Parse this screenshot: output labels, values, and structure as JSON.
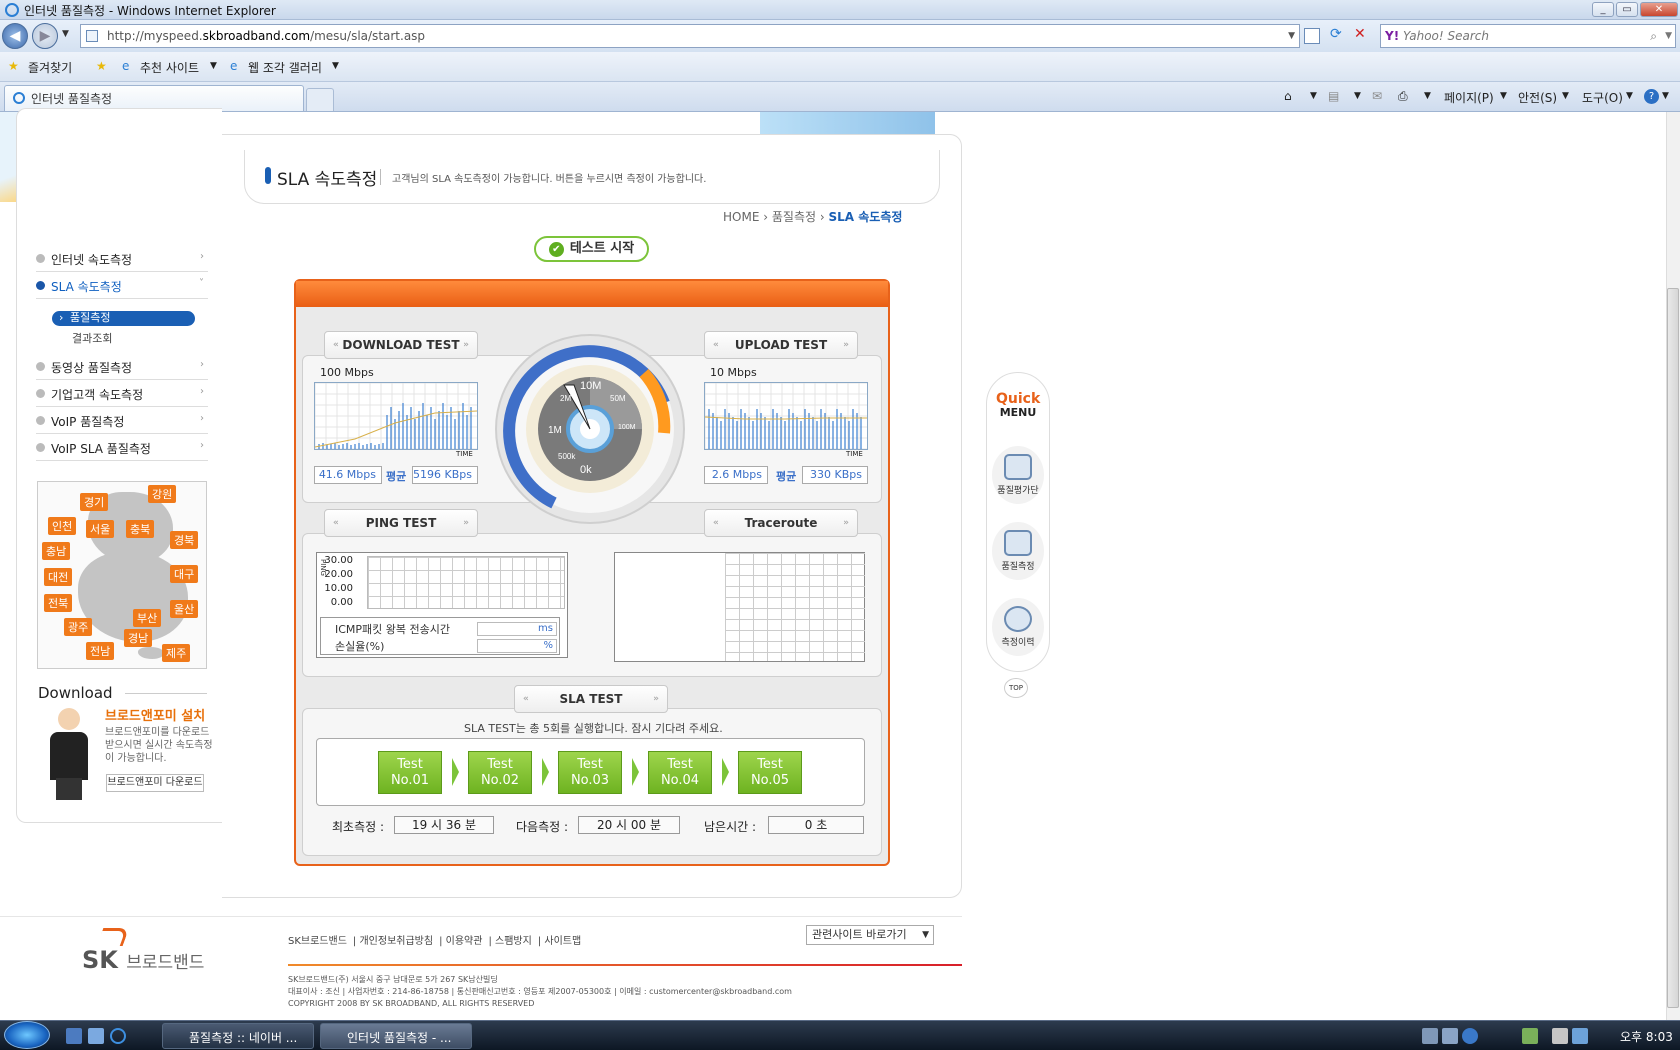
{
  "window": {
    "title": "인터넷 품질측정 - Windows Internet Explorer"
  },
  "browser": {
    "url_prefix": "http://myspeed.",
    "url_domain": "skbroadband.com",
    "url_path": "/mesu/sla/start.asp",
    "search_placeholder": "Yahoo! Search",
    "fav_label": "즐겨찾기",
    "fav_recommended": "추천 사이트",
    "fav_gallery": "웹 조각 갤러리",
    "tab_title": "인터넷 품질측정",
    "cmd_page": "페이지(P)",
    "cmd_safety": "안전(S)",
    "cmd_tools": "도구(O)"
  },
  "sidebar": {
    "items": [
      {
        "label": "인터넷 속도측정"
      },
      {
        "label": "SLA 속도측정"
      },
      {
        "label": "동영상 품질측정"
      },
      {
        "label": "기업고객 속도측정"
      },
      {
        "label": "VoIP 품질측정"
      },
      {
        "label": "VoIP SLA 품질측정"
      }
    ],
    "sub_items": [
      {
        "label": "품질측정"
      },
      {
        "label": "결과조회"
      }
    ],
    "map_regions": [
      "강원",
      "경기",
      "인천",
      "서울",
      "충북",
      "경북",
      "충남",
      "대전",
      "대구",
      "전북",
      "울산",
      "부산",
      "광주",
      "경남",
      "전남",
      "제주"
    ],
    "download": {
      "title": "Download",
      "heading": "브로드앤포미 설치",
      "text": "브로드앤포미를 다운로드 받으시면 실시간 속도측정이 가능합니다.",
      "button": "브로드앤포미 다운로드"
    }
  },
  "header": {
    "title": "SLA 속도측정",
    "description": "고객님의 SLA 속도측정이 가능합니다.  버튼을 누르시면 측정이 가능합니다.",
    "breadcrumb_home": "HOME",
    "breadcrumb_mid": "품질측정",
    "breadcrumb_current": "SLA 속도측정",
    "start_button": "테스트 시작"
  },
  "download_test": {
    "title": "DOWNLOAD TEST",
    "scale": "100 Mbps",
    "axis_label": "TIME",
    "speed": "41.6 Mbps",
    "avg_label": "평균",
    "kbps": "5196 KBps"
  },
  "upload_test": {
    "title": "UPLOAD TEST",
    "scale": "10 Mbps",
    "axis_label": "TIME",
    "speed": "2.6 Mbps",
    "avg_label": "평균",
    "kbps": "330 KBps"
  },
  "gauge": {
    "labels": [
      "0k",
      "500k",
      "1M",
      "2M",
      "10M",
      "50M",
      "100M"
    ],
    "needle_value": "2M"
  },
  "ping_test": {
    "title": "PING TEST",
    "y_axis_label": "PING",
    "y_ticks": [
      "30.00",
      "20.00",
      "10.00",
      "0.00"
    ],
    "icmp_label": "ICMP패킷 왕복 전송시간",
    "icmp_unit": "ms",
    "loss_label": "손실율(%)",
    "loss_unit": "%"
  },
  "traceroute": {
    "title": "Traceroute"
  },
  "sla_test": {
    "title": "SLA TEST",
    "message": "SLA TEST는 총 5회를 실행합니다. 잠시 기다려 주세요.",
    "tests": [
      {
        "line1": "Test",
        "line2": "No.01"
      },
      {
        "line1": "Test",
        "line2": "No.02"
      },
      {
        "line1": "Test",
        "line2": "No.03"
      },
      {
        "line1": "Test",
        "line2": "No.04"
      },
      {
        "line1": "Test",
        "line2": "No.05"
      }
    ],
    "first_label": "최초측정 :",
    "first_value": "19 시 36 분",
    "next_label": "다음측정 :",
    "next_value": "20 시 00 분",
    "remain_label": "남은시간 :",
    "remain_value": "0 초"
  },
  "quick_menu": {
    "title1": "Quick",
    "title2": "MENU",
    "items": [
      {
        "label": "품질평가단"
      },
      {
        "label": "품질측정"
      },
      {
        "label": "측정이력"
      }
    ],
    "top": "TOP"
  },
  "footer": {
    "links": [
      "SK브로드밴드",
      "개인정보취급방침",
      "이용약관",
      "스팸방지",
      "사이트맵"
    ],
    "related_select": "관련사이트 바로가기",
    "address1": "SK브로드밴드(주) 서울시 중구 남대문로 5가 267 SK남산빌딩",
    "address2": "대표이사 : 조신 | 사업자번호 : 214-86-18758 | 통신판매신고번호 : 영등포 제2007-05300호 | 이메일 : customercenter@skbroadband.com",
    "copyright": "COPYRIGHT 2008 BY SK BROADBAND, ALL RIGHTS RESERVED",
    "logo_sk": "SK",
    "logo_text": "브로드밴드"
  },
  "taskbar": {
    "buttons": [
      {
        "label": "품질측정 :: 네이버 ..."
      },
      {
        "label": "인터넷 품질측정 - ..."
      }
    ],
    "clock": "오후 8:03"
  },
  "colors": {
    "accent_orange": "#e8621a",
    "brand_blue": "#1a5fb4",
    "test_green": "#7cc43a"
  }
}
